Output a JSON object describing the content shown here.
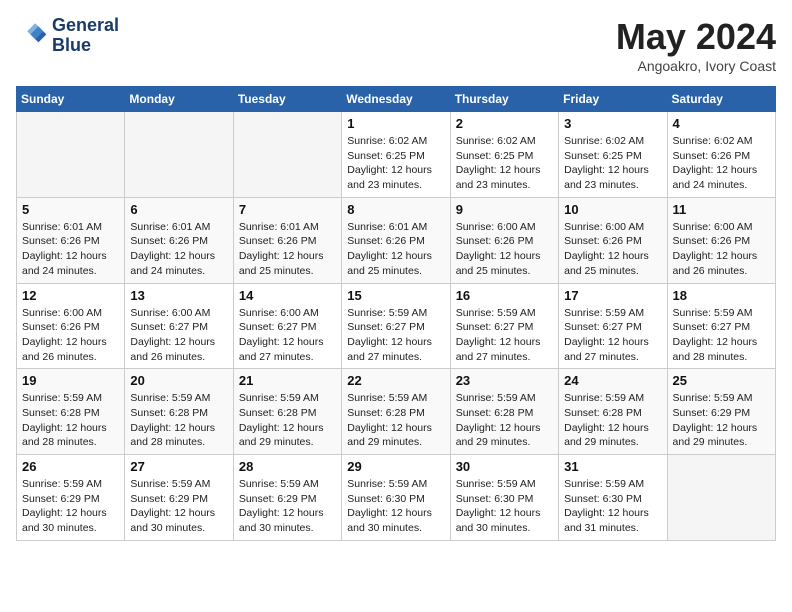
{
  "header": {
    "logo_line1": "General",
    "logo_line2": "Blue",
    "month": "May 2024",
    "location": "Angoakro, Ivory Coast"
  },
  "weekdays": [
    "Sunday",
    "Monday",
    "Tuesday",
    "Wednesday",
    "Thursday",
    "Friday",
    "Saturday"
  ],
  "weeks": [
    [
      {
        "day": "",
        "info": ""
      },
      {
        "day": "",
        "info": ""
      },
      {
        "day": "",
        "info": ""
      },
      {
        "day": "1",
        "info": "Sunrise: 6:02 AM\nSunset: 6:25 PM\nDaylight: 12 hours\nand 23 minutes."
      },
      {
        "day": "2",
        "info": "Sunrise: 6:02 AM\nSunset: 6:25 PM\nDaylight: 12 hours\nand 23 minutes."
      },
      {
        "day": "3",
        "info": "Sunrise: 6:02 AM\nSunset: 6:25 PM\nDaylight: 12 hours\nand 23 minutes."
      },
      {
        "day": "4",
        "info": "Sunrise: 6:02 AM\nSunset: 6:26 PM\nDaylight: 12 hours\nand 24 minutes."
      }
    ],
    [
      {
        "day": "5",
        "info": "Sunrise: 6:01 AM\nSunset: 6:26 PM\nDaylight: 12 hours\nand 24 minutes."
      },
      {
        "day": "6",
        "info": "Sunrise: 6:01 AM\nSunset: 6:26 PM\nDaylight: 12 hours\nand 24 minutes."
      },
      {
        "day": "7",
        "info": "Sunrise: 6:01 AM\nSunset: 6:26 PM\nDaylight: 12 hours\nand 25 minutes."
      },
      {
        "day": "8",
        "info": "Sunrise: 6:01 AM\nSunset: 6:26 PM\nDaylight: 12 hours\nand 25 minutes."
      },
      {
        "day": "9",
        "info": "Sunrise: 6:00 AM\nSunset: 6:26 PM\nDaylight: 12 hours\nand 25 minutes."
      },
      {
        "day": "10",
        "info": "Sunrise: 6:00 AM\nSunset: 6:26 PM\nDaylight: 12 hours\nand 25 minutes."
      },
      {
        "day": "11",
        "info": "Sunrise: 6:00 AM\nSunset: 6:26 PM\nDaylight: 12 hours\nand 26 minutes."
      }
    ],
    [
      {
        "day": "12",
        "info": "Sunrise: 6:00 AM\nSunset: 6:26 PM\nDaylight: 12 hours\nand 26 minutes."
      },
      {
        "day": "13",
        "info": "Sunrise: 6:00 AM\nSunset: 6:27 PM\nDaylight: 12 hours\nand 26 minutes."
      },
      {
        "day": "14",
        "info": "Sunrise: 6:00 AM\nSunset: 6:27 PM\nDaylight: 12 hours\nand 27 minutes."
      },
      {
        "day": "15",
        "info": "Sunrise: 5:59 AM\nSunset: 6:27 PM\nDaylight: 12 hours\nand 27 minutes."
      },
      {
        "day": "16",
        "info": "Sunrise: 5:59 AM\nSunset: 6:27 PM\nDaylight: 12 hours\nand 27 minutes."
      },
      {
        "day": "17",
        "info": "Sunrise: 5:59 AM\nSunset: 6:27 PM\nDaylight: 12 hours\nand 27 minutes."
      },
      {
        "day": "18",
        "info": "Sunrise: 5:59 AM\nSunset: 6:27 PM\nDaylight: 12 hours\nand 28 minutes."
      }
    ],
    [
      {
        "day": "19",
        "info": "Sunrise: 5:59 AM\nSunset: 6:28 PM\nDaylight: 12 hours\nand 28 minutes."
      },
      {
        "day": "20",
        "info": "Sunrise: 5:59 AM\nSunset: 6:28 PM\nDaylight: 12 hours\nand 28 minutes."
      },
      {
        "day": "21",
        "info": "Sunrise: 5:59 AM\nSunset: 6:28 PM\nDaylight: 12 hours\nand 29 minutes."
      },
      {
        "day": "22",
        "info": "Sunrise: 5:59 AM\nSunset: 6:28 PM\nDaylight: 12 hours\nand 29 minutes."
      },
      {
        "day": "23",
        "info": "Sunrise: 5:59 AM\nSunset: 6:28 PM\nDaylight: 12 hours\nand 29 minutes."
      },
      {
        "day": "24",
        "info": "Sunrise: 5:59 AM\nSunset: 6:28 PM\nDaylight: 12 hours\nand 29 minutes."
      },
      {
        "day": "25",
        "info": "Sunrise: 5:59 AM\nSunset: 6:29 PM\nDaylight: 12 hours\nand 29 minutes."
      }
    ],
    [
      {
        "day": "26",
        "info": "Sunrise: 5:59 AM\nSunset: 6:29 PM\nDaylight: 12 hours\nand 30 minutes."
      },
      {
        "day": "27",
        "info": "Sunrise: 5:59 AM\nSunset: 6:29 PM\nDaylight: 12 hours\nand 30 minutes."
      },
      {
        "day": "28",
        "info": "Sunrise: 5:59 AM\nSunset: 6:29 PM\nDaylight: 12 hours\nand 30 minutes."
      },
      {
        "day": "29",
        "info": "Sunrise: 5:59 AM\nSunset: 6:30 PM\nDaylight: 12 hours\nand 30 minutes."
      },
      {
        "day": "30",
        "info": "Sunrise: 5:59 AM\nSunset: 6:30 PM\nDaylight: 12 hours\nand 30 minutes."
      },
      {
        "day": "31",
        "info": "Sunrise: 5:59 AM\nSunset: 6:30 PM\nDaylight: 12 hours\nand 31 minutes."
      },
      {
        "day": "",
        "info": ""
      }
    ]
  ]
}
